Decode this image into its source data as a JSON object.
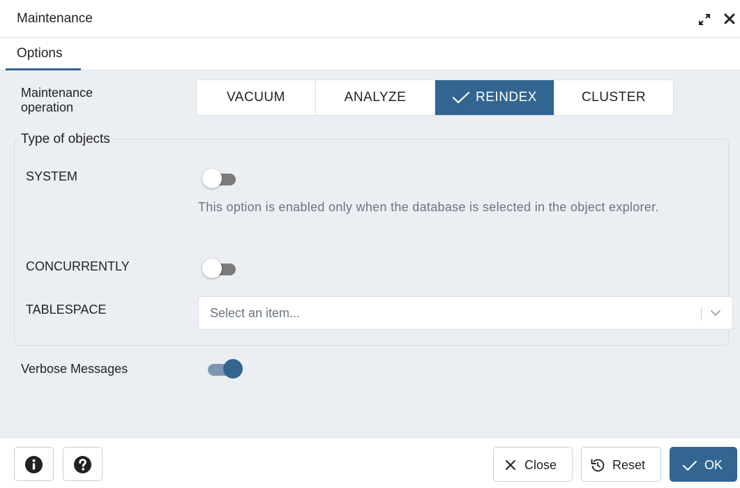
{
  "dialog": {
    "title": "Maintenance"
  },
  "tabs": [
    {
      "label": "Options"
    }
  ],
  "operation": {
    "label_line1": "Maintenance",
    "label_line2": "operation",
    "options": [
      "VACUUM",
      "ANALYZE",
      "REINDEX",
      "CLUSTER"
    ],
    "selected": "REINDEX"
  },
  "objects": {
    "legend": "Type of objects",
    "system": {
      "label": "SYSTEM",
      "on": false
    },
    "help": "This option is enabled only when the database is selected in the object explorer.",
    "concurrently": {
      "label": "CONCURRENTLY",
      "on": false
    },
    "tablespace": {
      "label": "TABLESPACE",
      "placeholder": "Select an item..."
    }
  },
  "verbose": {
    "label": "Verbose Messages",
    "on": true
  },
  "footer": {
    "close": "Close",
    "reset": "Reset",
    "ok": "OK"
  },
  "colors": {
    "accent": "#326690",
    "background": "#ebeef3",
    "muted_text": "#6b7480"
  }
}
